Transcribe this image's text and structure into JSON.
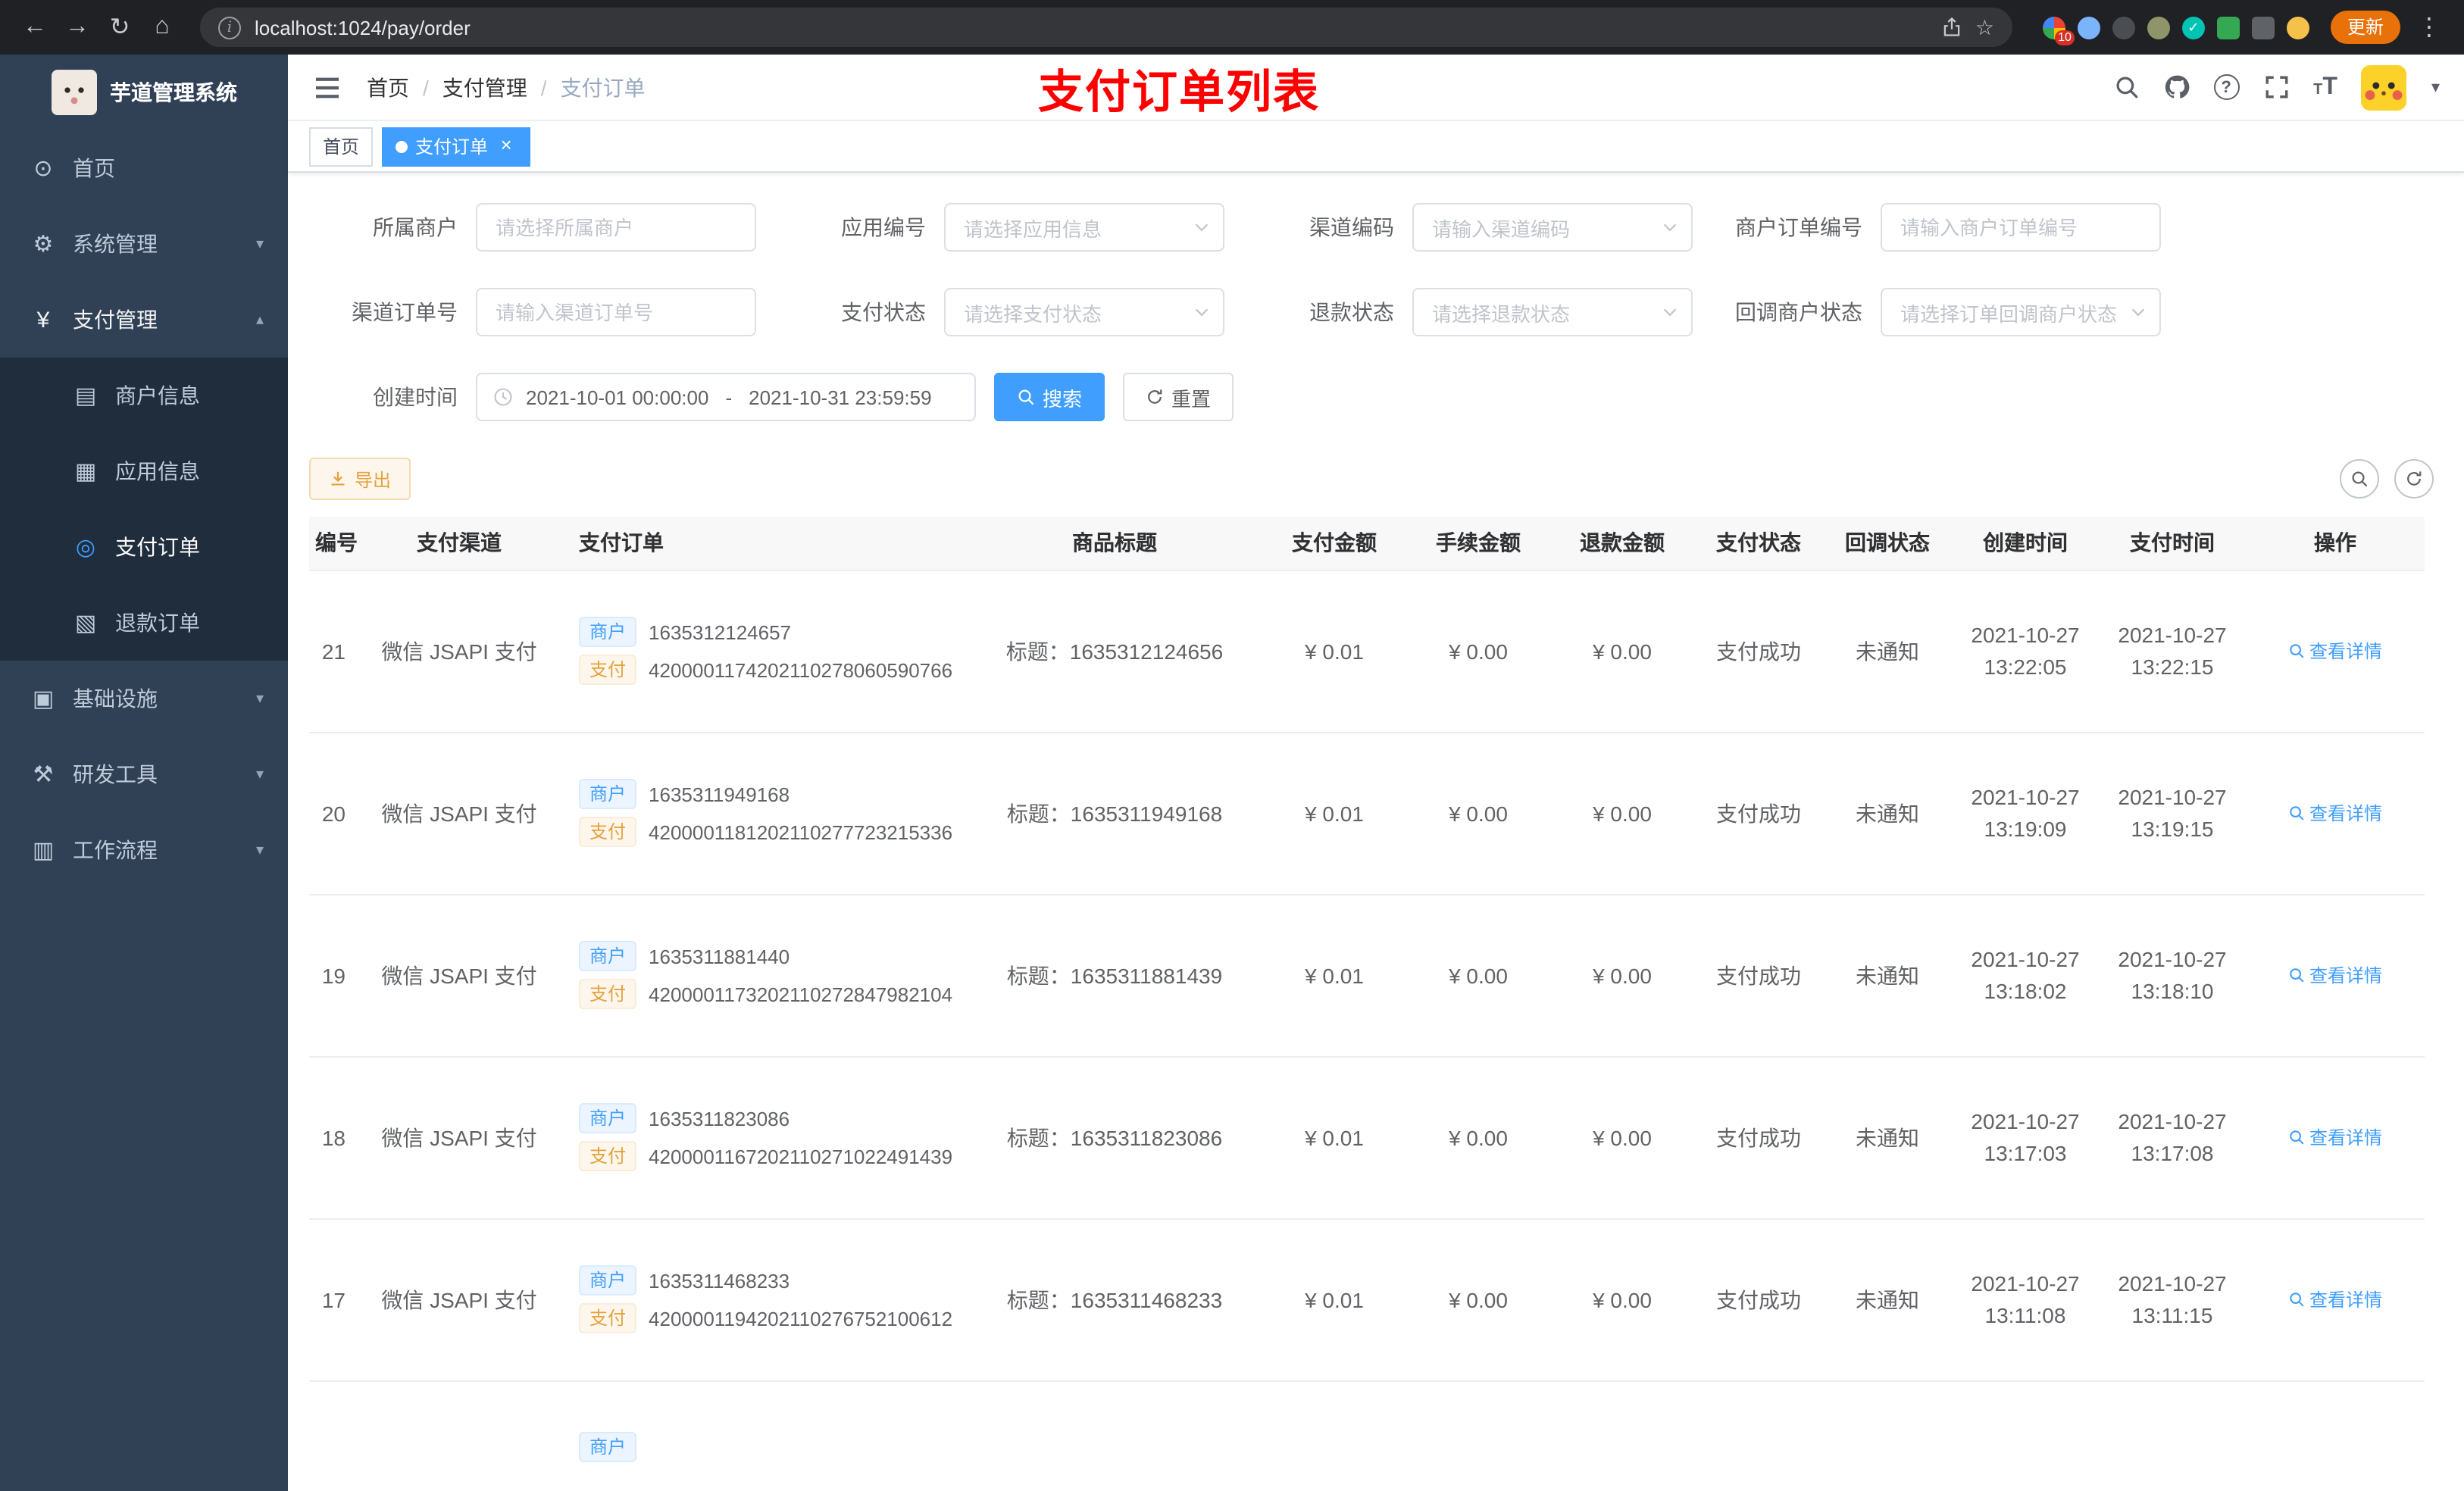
{
  "browser": {
    "url": "localhost:1024/pay/order",
    "update_label": "更新",
    "extensions_badge": "10"
  },
  "icons": {
    "back": "←",
    "forward": "→",
    "reload": "↻",
    "home": "⌂",
    "info": "i",
    "star": "☆",
    "more": "⋮",
    "check": "✓",
    "caret_down": "▾",
    "question": "?",
    "font_size": "T",
    "dashboard": "⊙",
    "gear": "⚙",
    "yen": "¥",
    "merchant_info": "▤",
    "app_info": "▦",
    "pay_order": "◎",
    "refund_order": "▧",
    "infrastructure": "▣",
    "dev_tools": "⚒",
    "workflow": "▥",
    "chevron_down": "▾",
    "chevron_up": "▴",
    "tab_close": "×"
  },
  "sidebar": {
    "logo_title": "芋道管理系统",
    "menu": [
      {
        "label": "首页"
      },
      {
        "label": "系统管理"
      },
      {
        "label": "支付管理"
      },
      {
        "label": "基础设施"
      },
      {
        "label": "研发工具"
      },
      {
        "label": "工作流程"
      }
    ],
    "submenu": [
      {
        "label": "商户信息"
      },
      {
        "label": "应用信息"
      },
      {
        "label": "支付订单"
      },
      {
        "label": "退款订单"
      }
    ]
  },
  "header": {
    "breadcrumb": [
      "首页",
      "支付管理",
      "支付订单"
    ],
    "breadcrumb_separator": "/",
    "banner": "支付订单列表"
  },
  "tabs": [
    {
      "label": "首页"
    },
    {
      "label": "支付订单"
    }
  ],
  "filters": {
    "row1": [
      {
        "label": "所属商户",
        "placeholder": "请选择所属商户"
      },
      {
        "label": "应用编号",
        "placeholder": "请选择应用信息"
      },
      {
        "label": "渠道编码",
        "placeholder": "请输入渠道编码"
      },
      {
        "label": "商户订单编号",
        "placeholder": "请输入商户订单编号"
      }
    ],
    "row2": [
      {
        "label": "渠道订单号",
        "placeholder": "请输入渠道订单号"
      },
      {
        "label": "支付状态",
        "placeholder": "请选择支付状态"
      },
      {
        "label": "退款状态",
        "placeholder": "请选择退款状态"
      },
      {
        "label": "回调商户状态",
        "placeholder": "请选择订单回调商户状态"
      }
    ],
    "create_time_label": "创建时间",
    "date_start": "2021-10-01 00:00:00",
    "date_separator": "-",
    "date_end": "2021-10-31 23:59:59",
    "search_label": "搜索",
    "reset_label": "重置"
  },
  "toolbar": {
    "export_label": "导出"
  },
  "table": {
    "tag_merchant": "商户",
    "tag_pay": "支付",
    "columns": [
      "编号",
      "支付渠道",
      "支付订单",
      "商品标题",
      "支付金额",
      "手续金额",
      "退款金额",
      "支付状态",
      "回调状态",
      "创建时间",
      "支付时间",
      "操作"
    ],
    "rows": [
      {
        "id": "21",
        "channel": "微信 JSAPI 支付",
        "merchant_no": "1635312124657",
        "channel_no": "4200001174202110278060590766",
        "title": "标题：1635312124656",
        "amount": "¥ 0.01",
        "fee": "¥ 0.00",
        "refund": "¥ 0.00",
        "status": "支付成功",
        "notify": "未通知",
        "create_date": "2021-10-27",
        "create_time": "13:22:05",
        "pay_date": "2021-10-27",
        "pay_time": "13:22:15",
        "action": "查看详情"
      },
      {
        "id": "20",
        "channel": "微信 JSAPI 支付",
        "merchant_no": "1635311949168",
        "channel_no": "4200001181202110277723215336",
        "title": "标题：1635311949168",
        "amount": "¥ 0.01",
        "fee": "¥ 0.00",
        "refund": "¥ 0.00",
        "status": "支付成功",
        "notify": "未通知",
        "create_date": "2021-10-27",
        "create_time": "13:19:09",
        "pay_date": "2021-10-27",
        "pay_time": "13:19:15",
        "action": "查看详情"
      },
      {
        "id": "19",
        "channel": "微信 JSAPI 支付",
        "merchant_no": "1635311881440",
        "channel_no": "4200001173202110272847982104",
        "title": "标题：1635311881439",
        "amount": "¥ 0.01",
        "fee": "¥ 0.00",
        "refund": "¥ 0.00",
        "status": "支付成功",
        "notify": "未通知",
        "create_date": "2021-10-27",
        "create_time": "13:18:02",
        "pay_date": "2021-10-27",
        "pay_time": "13:18:10",
        "action": "查看详情"
      },
      {
        "id": "18",
        "channel": "微信 JSAPI 支付",
        "merchant_no": "1635311823086",
        "channel_no": "4200001167202110271022491439",
        "title": "标题：1635311823086",
        "amount": "¥ 0.01",
        "fee": "¥ 0.00",
        "refund": "¥ 0.00",
        "status": "支付成功",
        "notify": "未通知",
        "create_date": "2021-10-27",
        "create_time": "13:17:03",
        "pay_date": "2021-10-27",
        "pay_time": "13:17:08",
        "action": "查看详情"
      },
      {
        "id": "17",
        "channel": "微信 JSAPI 支付",
        "merchant_no": "1635311468233",
        "channel_no": "4200001194202110276752100612",
        "title": "标题：1635311468233",
        "amount": "¥ 0.01",
        "fee": "¥ 0.00",
        "refund": "¥ 0.00",
        "status": "支付成功",
        "notify": "未通知",
        "create_date": "2021-10-27",
        "create_time": "13:11:08",
        "pay_date": "2021-10-27",
        "pay_time": "13:11:15",
        "action": "查看详情"
      }
    ],
    "partial_row": {
      "tag": "商户"
    }
  }
}
